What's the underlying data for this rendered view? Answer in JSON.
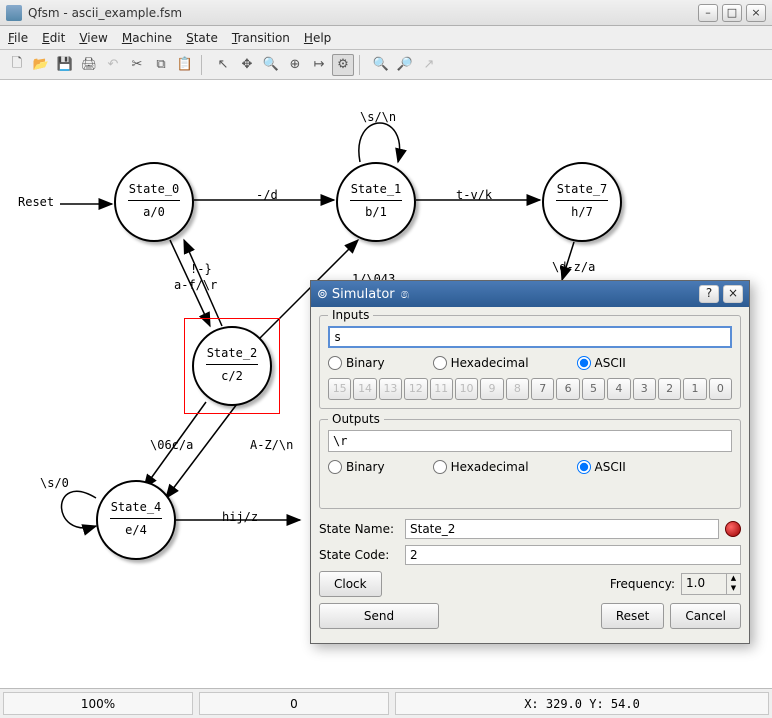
{
  "window": {
    "title": "Qfsm - ascii_example.fsm"
  },
  "menu": {
    "file": "File",
    "edit": "Edit",
    "view": "View",
    "machine": "Machine",
    "state": "State",
    "transition": "Transition",
    "help": "Help"
  },
  "canvas": {
    "reset_label": "Reset",
    "states": {
      "s0": {
        "name": "State_0",
        "out": "a/0"
      },
      "s1": {
        "name": "State_1",
        "out": "b/1"
      },
      "s2": {
        "name": "State_2",
        "out": "c/2"
      },
      "s4": {
        "name": "State_4",
        "out": "e/4"
      },
      "s7": {
        "name": "State_7",
        "out": "h/7"
      }
    },
    "transitions": {
      "t01": "-/d",
      "t11": "\\s/\\n",
      "t17": "t-v/k",
      "t7d": "\\d-z/a",
      "t02a": "!-}",
      "t02b": "a-f/\\r",
      "t21": "1/\\043",
      "t24a": "\\06c/a",
      "t24b": "A-Z/\\n",
      "t44": "\\s/0",
      "t4_": "hij/z"
    }
  },
  "statusbar": {
    "zoom": "100%",
    "sel": "0",
    "coords": "X: 329.0  Y: 54.0"
  },
  "dialog": {
    "title": "Simulator",
    "inputs": {
      "legend": "Inputs",
      "value": "s",
      "r_binary": "Binary",
      "r_hex": "Hexadecimal",
      "r_ascii": "ASCII",
      "bits": [
        "15",
        "14",
        "13",
        "12",
        "11",
        "10",
        "9",
        "8",
        "7",
        "6",
        "5",
        "4",
        "3",
        "2",
        "1",
        "0"
      ]
    },
    "outputs": {
      "legend": "Outputs",
      "value": "\\r",
      "r_binary": "Binary",
      "r_hex": "Hexadecimal",
      "r_ascii": "ASCII"
    },
    "state_name_lbl": "State Name:",
    "state_name_val": "State_2",
    "state_code_lbl": "State Code:",
    "state_code_val": "2",
    "clock_btn": "Clock",
    "freq_lbl": "Frequency:",
    "freq_val": "1.0",
    "send_btn": "Send",
    "reset_btn": "Reset",
    "cancel_btn": "Cancel"
  }
}
